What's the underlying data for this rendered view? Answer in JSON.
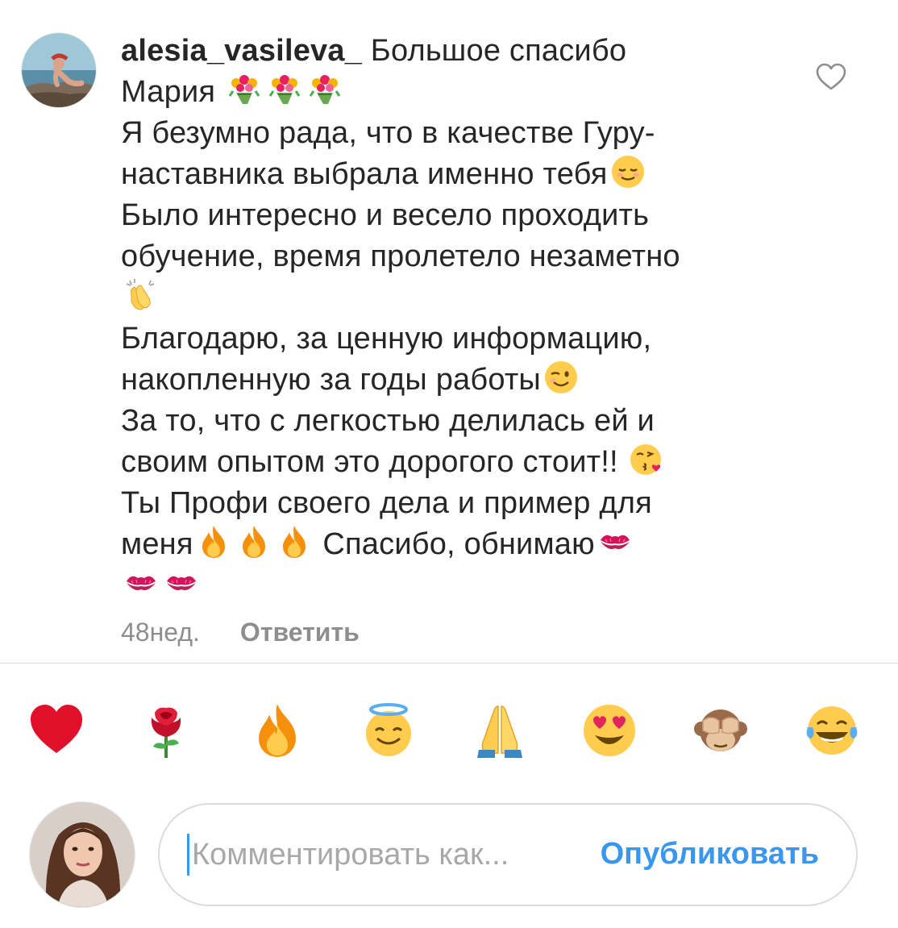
{
  "comment": {
    "username": "alesia_vasileva_",
    "lines": [
      " Большое спасибо",
      "Мария",
      "Я безумно рада, что в качестве Гуру-",
      "наставника выбрала именно тебя",
      "Было интересно и весело проходить",
      "обучение, время пролетело незаметно",
      "",
      "Благодарю, за ценную информацию,",
      "накопленную за годы работы",
      "За то, что с легкостью делилась ей и",
      "своим опытом это дорогого стоит!!",
      "Ты Профи своего дела и пример для",
      "меня",
      " Спасибо, обнимаю",
      ""
    ],
    "emojis": {
      "line2": [
        "bouquet",
        "bouquet",
        "bouquet"
      ],
      "line4": [
        "relieved-face"
      ],
      "line7": [
        "clapping-hands"
      ],
      "line9": [
        "winking-face"
      ],
      "line11": [
        "kissing-face-with-heart"
      ],
      "line13": [
        "fire",
        "fire",
        "fire"
      ],
      "line14": [
        "kiss-mark"
      ],
      "line15": [
        "kiss-mark",
        "kiss-mark"
      ]
    },
    "time": "48нед.",
    "reply_label": "Ответить",
    "like_icon": "heart-outline-icon"
  },
  "reactions": [
    {
      "name": "red-heart",
      "icon": "red-heart-icon"
    },
    {
      "name": "rose",
      "icon": "rose-icon"
    },
    {
      "name": "fire",
      "icon": "fire-icon"
    },
    {
      "name": "halo-face",
      "icon": "smiling-face-with-halo-icon"
    },
    {
      "name": "folded-hands",
      "icon": "folded-hands-icon"
    },
    {
      "name": "heart-eyes",
      "icon": "heart-eyes-face-icon"
    },
    {
      "name": "see-no-evil-monkey",
      "icon": "see-no-evil-monkey-icon"
    },
    {
      "name": "tears-of-joy",
      "icon": "face-with-tears-of-joy-icon"
    }
  ],
  "composer": {
    "placeholder": "Комментировать как...",
    "value": "",
    "publish_label": "Опубликовать"
  },
  "colors": {
    "accent": "#3897f0",
    "text": "#262626",
    "muted": "#8e8e8e",
    "divider": "#dbdbdb"
  }
}
